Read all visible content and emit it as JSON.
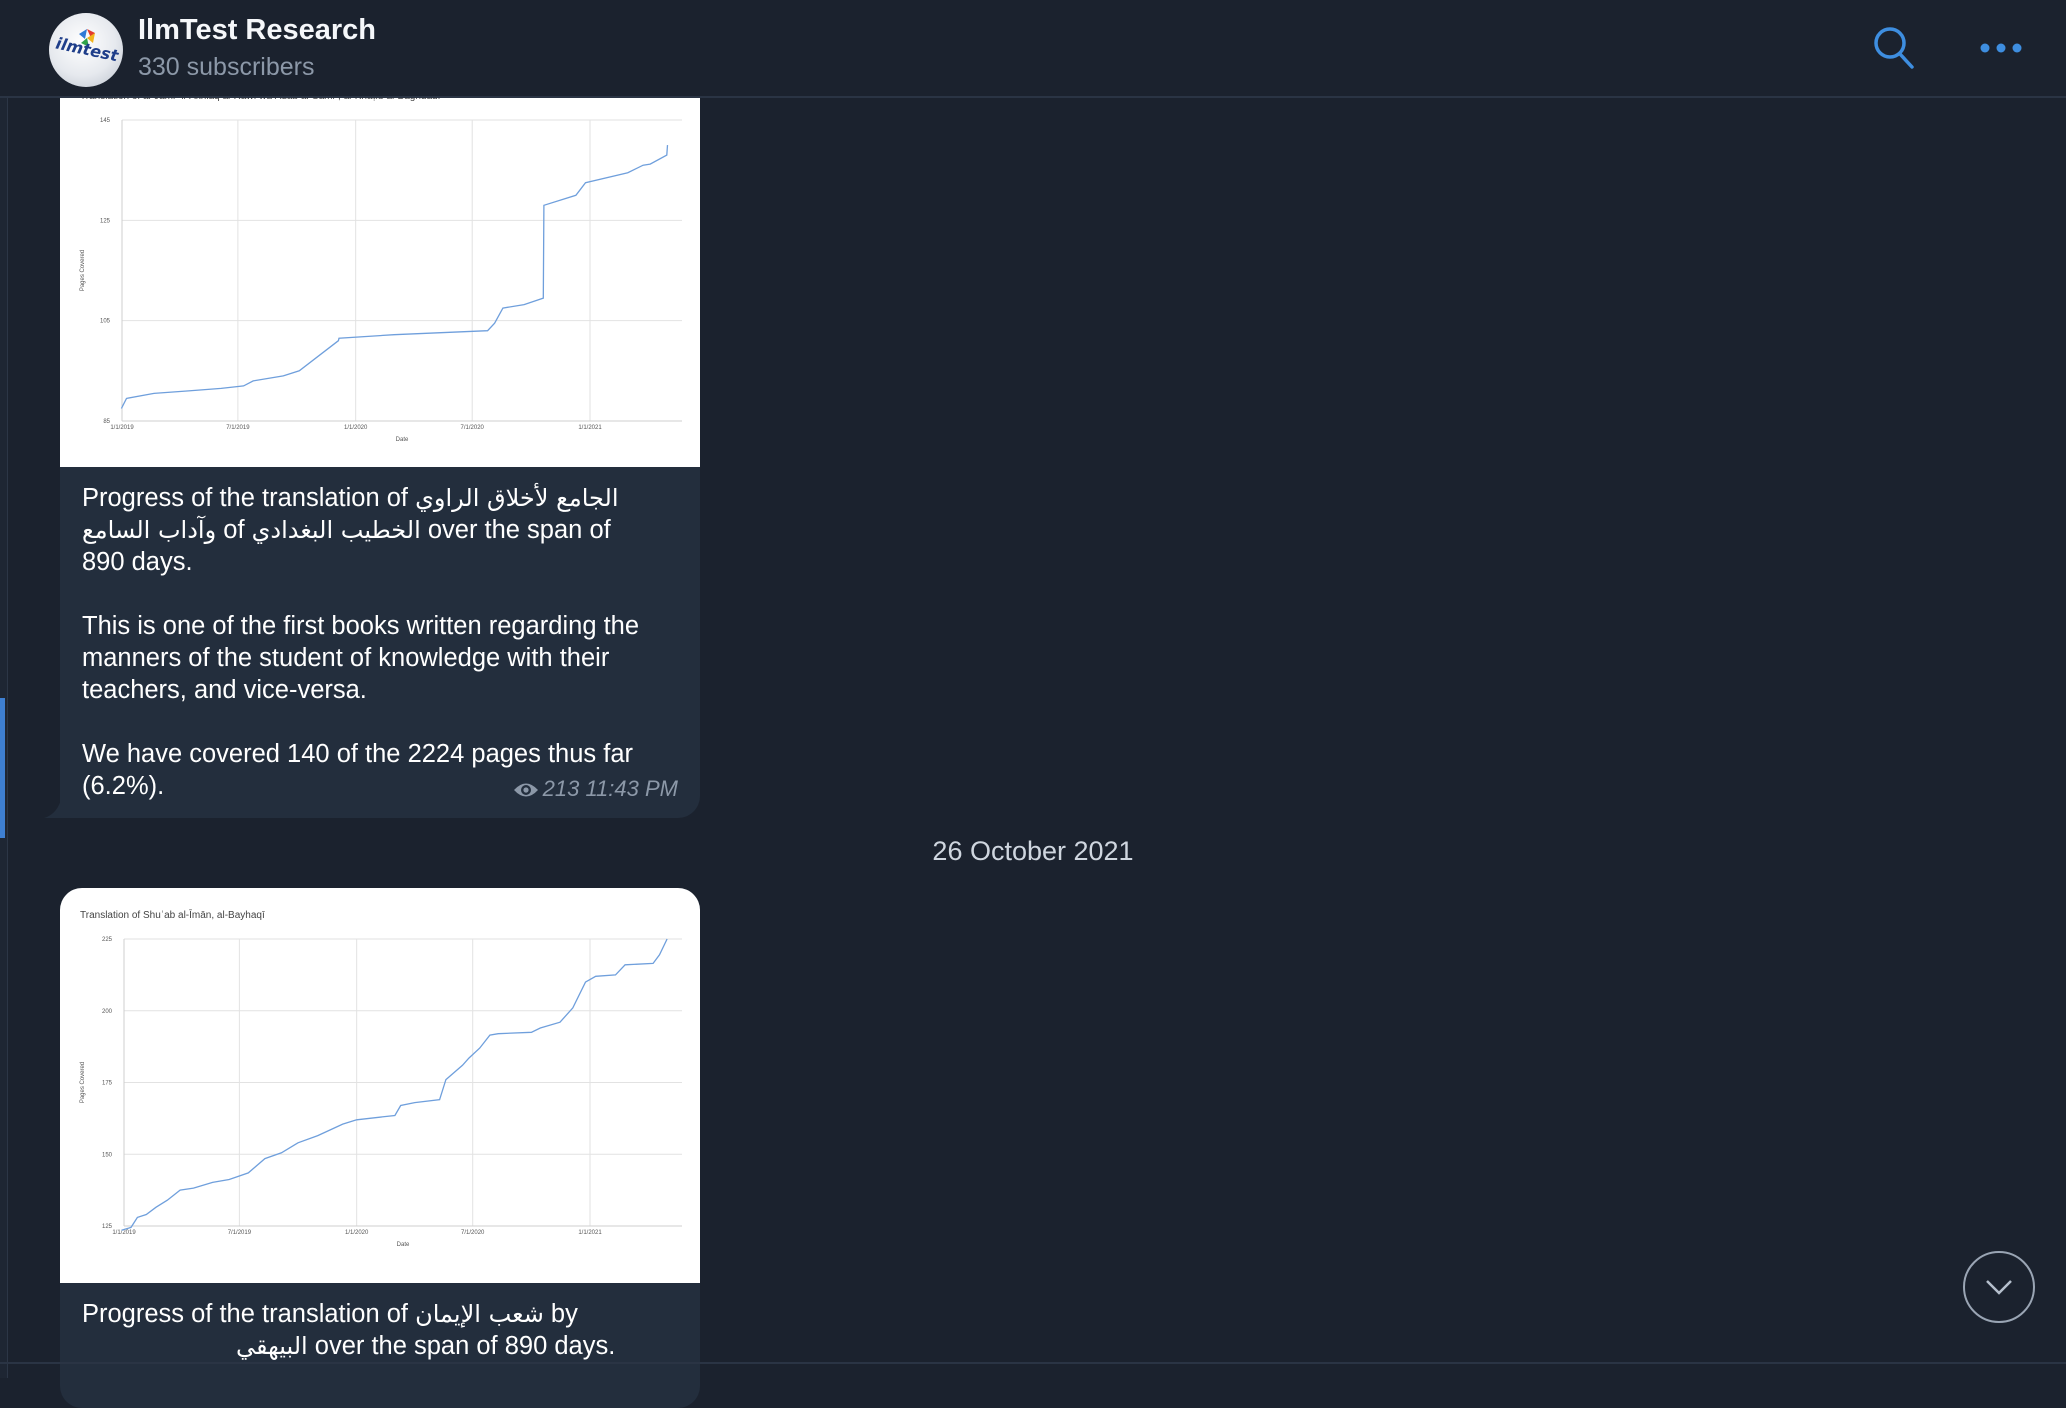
{
  "channel": {
    "name": "IlmTest Research",
    "subscribers": "330 subscribers",
    "avatar_text": "ilmtest"
  },
  "icons": {
    "search": "search-icon",
    "more": "more-dots-icon",
    "views": "eye-icon",
    "scroll_down": "chevron-down-icon"
  },
  "colors": {
    "background": "#1b222e",
    "bubble": "#232e3d",
    "accent": "#3e8ee0",
    "muted": "#8c98a8",
    "line": "#6f9fdc"
  },
  "messages": [
    {
      "caption_line1_en": "Progress of the translation of ",
      "caption_line1_ar": "الجامع لأخلاق الراوي",
      "caption_line2_ar1": " وآداب السامع",
      "caption_line2_en1": " of ",
      "caption_line2_ar2": "الخطيب البغدادي",
      "caption_line2_en2": " over the span of",
      "caption_line3": "890 days.",
      "paragraph2": "This is one of the first books written regarding the manners of the student of knowledge with their teachers, and vice-versa.",
      "paragraph3": "We have covered 140 of the 2224 pages thus far (6.2%).",
      "views": "213",
      "time": "11:43 PM"
    },
    {
      "caption_line1_en": "Progress of the translation of ",
      "caption_line1_ar": "شعب الإيمان",
      "caption_line1_en2": " by",
      "caption_line2_ar": "البيهقي",
      "caption_line2_en": " over the span of 890 days."
    }
  ],
  "date_separator": "26 October 2021",
  "chart_data": [
    {
      "type": "line",
      "title": "Translation of al-Jāmiʿ li-Akhlāq al-Rāwī wa Ādāb al-Sāmiʿ, al-Khaṭīb al-Baghdādī",
      "xlabel": "Date",
      "ylabel": "Pages Covered",
      "x_ticks": [
        "1/1/2019",
        "7/1/2019",
        "1/1/2020",
        "7/1/2020",
        "1/1/2021"
      ],
      "y_ticks": [
        85,
        105,
        125,
        145
      ],
      "ylim": [
        85,
        145
      ],
      "grid": true,
      "series": [
        {
          "x": [
            "2018-12-31",
            "2019-01-08",
            "2019-02-20",
            "2019-04-15",
            "2019-06-05",
            "2019-07-10",
            "2019-07-25",
            "2019-09-10",
            "2019-10-05",
            "2019-12-05",
            "2019-12-06",
            "2020-03-01",
            "2020-07-25",
            "2020-08-05",
            "2020-08-18",
            "2020-09-20",
            "2020-10-20",
            "2020-10-21",
            "2020-12-10",
            "2020-12-25",
            "2021-03-01",
            "2021-03-25",
            "2021-04-05",
            "2021-05-01",
            "2021-05-02"
          ],
          "y": [
            87.5,
            89.5,
            90.5,
            91,
            91.5,
            92,
            93,
            94,
            95,
            101,
            101.5,
            102.2,
            103,
            104.5,
            107.5,
            108.2,
            109.5,
            128,
            130,
            132.5,
            134.5,
            136,
            136.2,
            138,
            140
          ]
        }
      ]
    },
    {
      "type": "line",
      "title": "Translation of Shuʿab al-Īmān, al-Bayhaqī",
      "xlabel": "Date",
      "ylabel": "Pages Covered",
      "x_ticks": [
        "1/1/2019",
        "7/1/2019",
        "1/1/2020",
        "7/1/2020",
        "1/1/2021"
      ],
      "y_ticks": [
        125,
        150,
        175,
        200,
        225
      ],
      "ylim": [
        125,
        225
      ],
      "grid": true,
      "series": [
        {
          "x": [
            "2018-12-28",
            "2019-01-12",
            "2019-01-22",
            "2019-02-05",
            "2019-02-20",
            "2019-03-10",
            "2019-03-30",
            "2019-04-20",
            "2019-05-20",
            "2019-06-15",
            "2019-07-15",
            "2019-08-10",
            "2019-09-05",
            "2019-10-01",
            "2019-11-01",
            "2019-12-10",
            "2020-01-01",
            "2020-02-10",
            "2020-03-01",
            "2020-03-10",
            "2020-04-01",
            "2020-05-10",
            "2020-05-20",
            "2020-06-15",
            "2020-06-25",
            "2020-07-12",
            "2020-07-28",
            "2020-08-10",
            "2020-10-01",
            "2020-10-15",
            "2020-11-15",
            "2020-12-05",
            "2020-12-25",
            "2021-01-10",
            "2021-02-10",
            "2021-02-25",
            "2021-04-10",
            "2021-04-20",
            "2021-05-02"
          ],
          "y": [
            123.5,
            124.5,
            128,
            129,
            131.5,
            134,
            137.5,
            138.2,
            140.2,
            141.2,
            143.5,
            148.5,
            150.5,
            154,
            156.5,
            160.5,
            162,
            163,
            163.5,
            167,
            168,
            169,
            176,
            181,
            183.5,
            187,
            191.5,
            192,
            192.5,
            194,
            196,
            201,
            210,
            212,
            212.5,
            216,
            216.5,
            219.5,
            225
          ]
        }
      ]
    }
  ]
}
